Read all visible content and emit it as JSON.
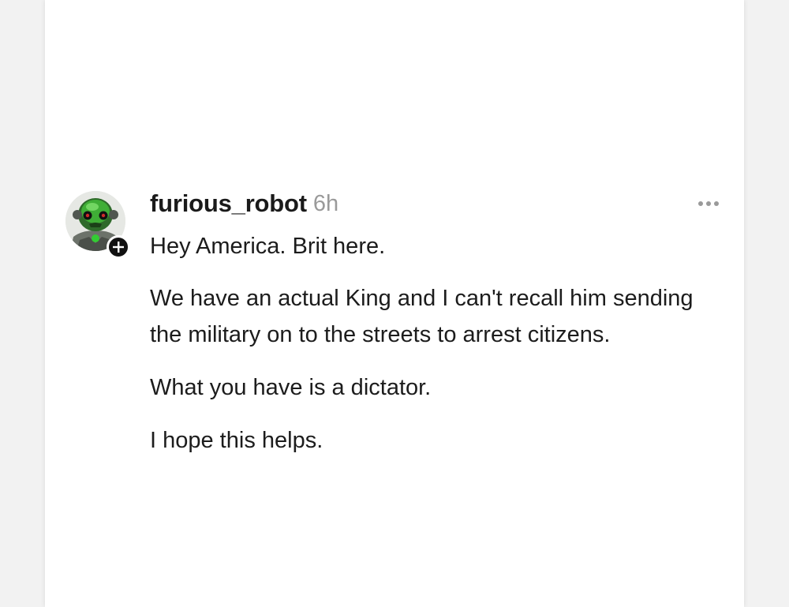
{
  "post": {
    "username": "furious_robot",
    "timestamp": "6h",
    "more_icon": "ellipsis-icon",
    "follow_icon": "plus-icon",
    "paragraphs": [
      "Hey America. Brit here.",
      "We have an actual King and I can't recall him sending the military on to the streets to arrest citizens.",
      "What you have is a dictator.",
      "I hope this helps."
    ]
  },
  "colors": {
    "card_background": "#ffffff",
    "page_background": "#f2f2f2",
    "username": "#1a1a1a",
    "timestamp": "#9a9a9a",
    "body_text": "#1c1c1c",
    "avatar_accent": "#33cc33"
  }
}
